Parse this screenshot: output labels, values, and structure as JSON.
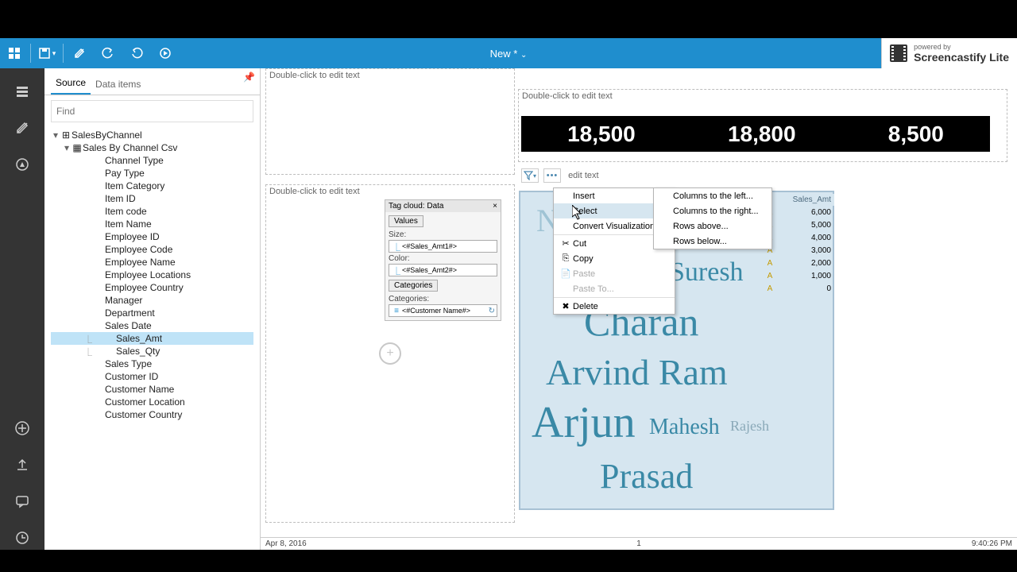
{
  "doc_title": "New *",
  "screencast": {
    "line1": "powered by",
    "line2": "Screencastify Lite"
  },
  "panel": {
    "tabs": {
      "source": "Source",
      "dataitems": "Data items"
    },
    "find_placeholder": "Find",
    "tree": {
      "root": "SalesByChannel",
      "csv": "Sales By Channel Csv",
      "fields": [
        "Channel Type",
        "Pay Type",
        "Item Category",
        "Item ID",
        "Item code",
        "Item Name",
        "Employee ID",
        "Employee Code",
        "Employee Name",
        "Employee Locations",
        "Employee Country",
        "Manager",
        "Department",
        "Sales Date"
      ],
      "measures": [
        "Sales_Amt",
        "Sales_Qty"
      ],
      "fields2": [
        "Sales Type",
        "Customer ID",
        "Customer Name",
        "Customer Location",
        "Customer Country"
      ],
      "selected": "Sales_Amt"
    }
  },
  "placeholders": {
    "p1": "Double-click to edit text",
    "p2": "Double-click to edit text",
    "p3": "Double-click to edit text",
    "p4": "edit text"
  },
  "kpis": [
    "18,500",
    "18,800",
    "8,500"
  ],
  "properties": {
    "title": "Tag cloud: Data",
    "values_btn": "Values",
    "size_label": "Size:",
    "size_val": "<#Sales_Amt1#>",
    "color_label": "Color:",
    "color_val": "<#Sales_Amt2#>",
    "cat_btn": "Categories",
    "cat_label": "Categories:",
    "cat_val": "<#Customer Name#>"
  },
  "context_menu": {
    "items": [
      "Insert",
      "Select",
      "Convert Visualization...",
      "Cut",
      "Copy",
      "Paste",
      "Paste To...",
      "Delete"
    ],
    "selected_index": 1
  },
  "submenu": [
    "Columns to the left...",
    "Columns to the right...",
    "Rows above...",
    "Rows below..."
  ],
  "tagcloud_words": [
    "N",
    "Suresh",
    "Charan",
    "Arvind Ram",
    "Arjun",
    "Mahesh",
    "Rajesh",
    "Prasad"
  ],
  "side_table": {
    "header": "Sales_Amt",
    "rows": [
      "6,000",
      "5,000",
      "4,000",
      "3,000",
      "2,000",
      "1,000",
      "0"
    ]
  },
  "status": {
    "date": "Apr 8, 2016",
    "mid": "1",
    "time": "9:40:26 PM"
  }
}
